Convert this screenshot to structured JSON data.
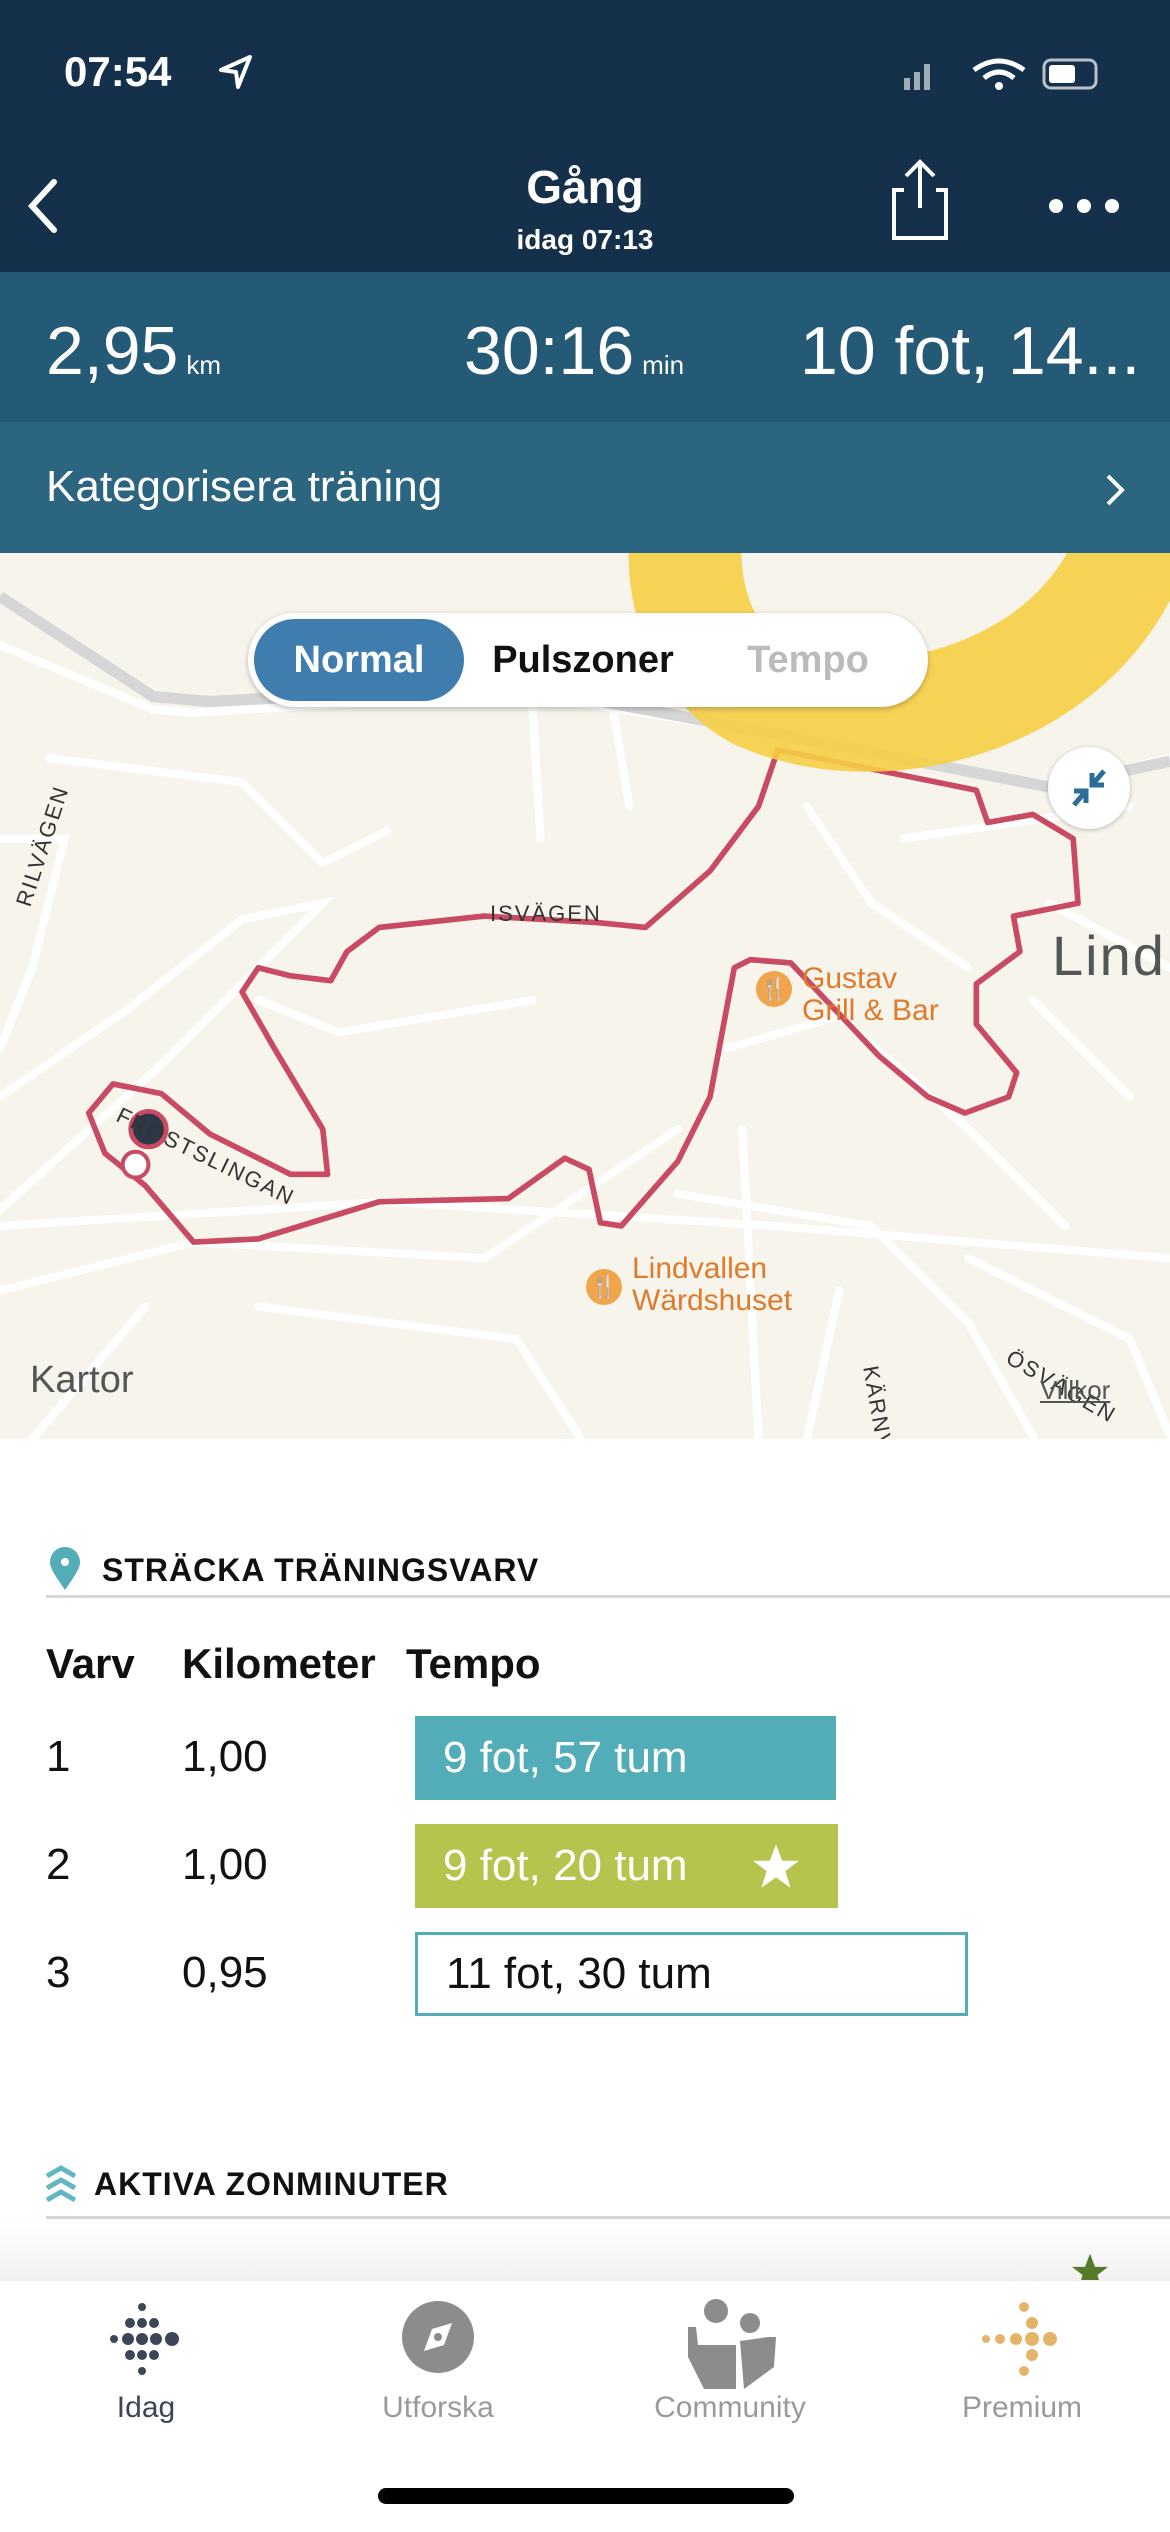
{
  "status_bar": {
    "time": "07:54"
  },
  "header": {
    "title": "Gång",
    "subtitle": "idag 07:13"
  },
  "stats": {
    "distance": "2,95",
    "distance_unit": "km",
    "duration": "30:16",
    "duration_unit": "min",
    "pace": "10 fot, 14..."
  },
  "categorize": {
    "label": "Kategorisera träning"
  },
  "map": {
    "segments": [
      "Normal",
      "Pulszoner",
      "Tempo"
    ],
    "selected_segment": "Normal",
    "streets": [
      "ISVÄGEN",
      "FROSTSLINGAN",
      "RILVÄGEN",
      "KÄRNVÄGEN",
      "ÖSVÄGEN"
    ],
    "places": [
      "Lind"
    ],
    "poi": [
      {
        "line1": "Gustav",
        "line2": "Grill & Bar"
      },
      {
        "line1": "Lindvallen",
        "line2": "Wärdshuset"
      }
    ],
    "attribution": "Kartor",
    "legal": "Villkor",
    "route_color": "#c84a63"
  },
  "laps": {
    "title": "STRÄCKA TRÄNINGSVARV",
    "headers": [
      "Varv",
      "Kilometer",
      "Tempo"
    ],
    "rows": [
      {
        "lap": "1",
        "km": "1,00",
        "pace": "9 fot, 57 tum",
        "color": "#52adb8"
      },
      {
        "lap": "2",
        "km": "1,00",
        "pace": "9 fot, 20 tum",
        "color": "#b6c34c",
        "best": true
      },
      {
        "lap": "3",
        "km": "0,95",
        "pace": "11 fot, 30 tum",
        "color": "#ffffff"
      }
    ]
  },
  "zone": {
    "title": "AKTIVA ZONMINUTER"
  },
  "tabs": [
    {
      "label": "Idag",
      "active": true
    },
    {
      "label": "Utforska"
    },
    {
      "label": "Community"
    },
    {
      "label": "Premium"
    }
  ]
}
